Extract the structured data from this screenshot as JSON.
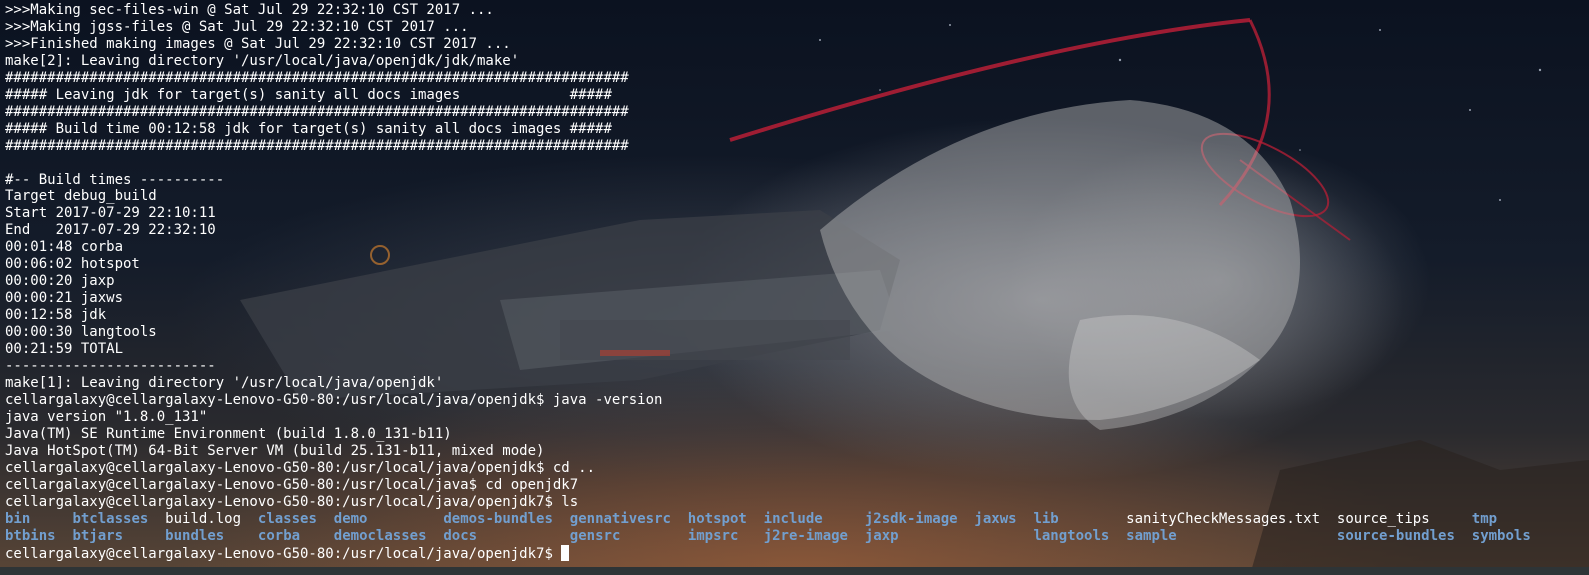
{
  "terminal": {
    "lines": [
      ">>>Making sec-files-win @ Sat Jul 29 22:32:10 CST 2017 ...",
      ">>>Making jgss-files @ Sat Jul 29 22:32:10 CST 2017 ...",
      ">>>Finished making images @ Sat Jul 29 22:32:10 CST 2017 ...",
      "make[2]: Leaving directory '/usr/local/java/openjdk/jdk/make'",
      "##########################################################################",
      "##### Leaving jdk for target(s) sanity all docs images             #####",
      "##########################################################################",
      "##### Build time 00:12:58 jdk for target(s) sanity all docs images #####",
      "##########################################################################",
      "",
      "#-- Build times ----------",
      "Target debug_build",
      "Start 2017-07-29 22:10:11",
      "End   2017-07-29 22:32:10",
      "00:01:48 corba",
      "00:06:02 hotspot",
      "00:00:20 jaxp",
      "00:00:21 jaxws",
      "00:12:58 jdk",
      "00:00:30 langtools",
      "00:21:59 TOTAL",
      "-------------------------",
      "make[1]: Leaving directory '/usr/local/java/openjdk'",
      "cellargalaxy@cellargalaxy-Lenovo-G50-80:/usr/local/java/openjdk$ java -version",
      "java version \"1.8.0_131\"",
      "Java(TM) SE Runtime Environment (build 1.8.0_131-b11)",
      "Java HotSpot(TM) 64-Bit Server VM (build 25.131-b11, mixed mode)",
      "cellargalaxy@cellargalaxy-Lenovo-G50-80:/usr/local/java/openjdk$ cd ..",
      "cellargalaxy@cellargalaxy-Lenovo-G50-80:/usr/local/java$ cd openjdk7",
      "cellargalaxy@cellargalaxy-Lenovo-G50-80:/usr/local/java/openjdk7$ ls"
    ],
    "ls_rows": [
      [
        {
          "name": "bin",
          "kind": "dir"
        },
        {
          "name": "btclasses",
          "kind": "dir"
        },
        {
          "name": "build.log",
          "kind": "file"
        },
        {
          "name": "classes",
          "kind": "dir"
        },
        {
          "name": "demo",
          "kind": "dir"
        },
        {
          "name": "demos-bundles",
          "kind": "dir"
        },
        {
          "name": "gennativesrc",
          "kind": "dir"
        },
        {
          "name": "hotspot",
          "kind": "dir"
        },
        {
          "name": "include",
          "kind": "dir"
        },
        {
          "name": "j2sdk-image",
          "kind": "dir"
        },
        {
          "name": "jaxws",
          "kind": "dir"
        },
        {
          "name": "lib",
          "kind": "dir"
        },
        {
          "name": "sanityCheckMessages.txt",
          "kind": "file"
        },
        {
          "name": "source_tips",
          "kind": "file"
        },
        {
          "name": "tmp",
          "kind": "dir"
        }
      ],
      [
        {
          "name": "btbins",
          "kind": "dir"
        },
        {
          "name": "btjars",
          "kind": "dir"
        },
        {
          "name": "bundles",
          "kind": "dir"
        },
        {
          "name": "corba",
          "kind": "dir"
        },
        {
          "name": "democlasses",
          "kind": "dir"
        },
        {
          "name": "docs",
          "kind": "dir"
        },
        {
          "name": "gensrc",
          "kind": "dir"
        },
        {
          "name": "impsrc",
          "kind": "dir"
        },
        {
          "name": "j2re-image",
          "kind": "dir"
        },
        {
          "name": "jaxp",
          "kind": "dir"
        },
        {
          "name": "",
          "kind": "dir"
        },
        {
          "name": "langtools",
          "kind": "dir"
        },
        {
          "name": "sample",
          "kind": "dir"
        },
        {
          "name": "source-bundles",
          "kind": "dir"
        },
        {
          "name": "symbols",
          "kind": "dir"
        }
      ]
    ],
    "prompt": "cellargalaxy@cellargalaxy-Lenovo-G50-80:/usr/local/java/openjdk7$ ",
    "colors": {
      "foreground": "#ffffff",
      "directory": "#729fcf",
      "halo": "#c8283c"
    }
  }
}
